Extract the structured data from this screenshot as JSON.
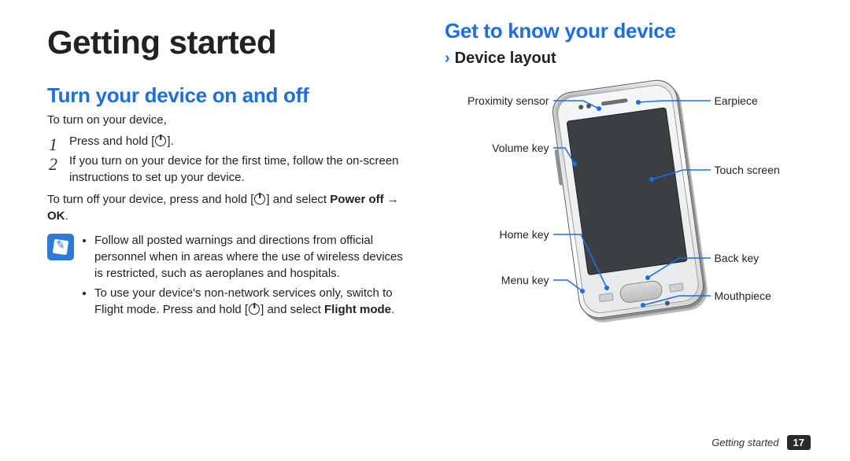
{
  "title": "Getting started",
  "left": {
    "heading": "Turn your device on and off",
    "intro": "To turn on your device,",
    "step1_a": "Press and hold [",
    "step1_b": "].",
    "step2": "If you turn on your device for the first time, follow the on-screen instructions to set up your device.",
    "off_a": "To turn off your device, press and hold [",
    "off_b": "] and select ",
    "off_bold": "Power off → OK",
    "off_c": ".",
    "note1": "Follow all posted warnings and directions from official personnel when in areas where the use of wireless devices is restricted, such as aeroplanes and hospitals.",
    "note2_a": "To use your device's non-network services only, switch to Flight mode. Press and hold [",
    "note2_b": "] and select ",
    "note2_bold": "Flight mode",
    "note2_c": "."
  },
  "right": {
    "heading": "Get to know your device",
    "subheading": "Device layout",
    "labels": {
      "proximity": "Proximity sensor",
      "volume": "Volume key",
      "home": "Home key",
      "menu": "Menu key",
      "earpiece": "Earpiece",
      "touch": "Touch screen",
      "back": "Back key",
      "mouth": "Mouthpiece"
    }
  },
  "footer": {
    "section": "Getting started",
    "page": "17"
  }
}
